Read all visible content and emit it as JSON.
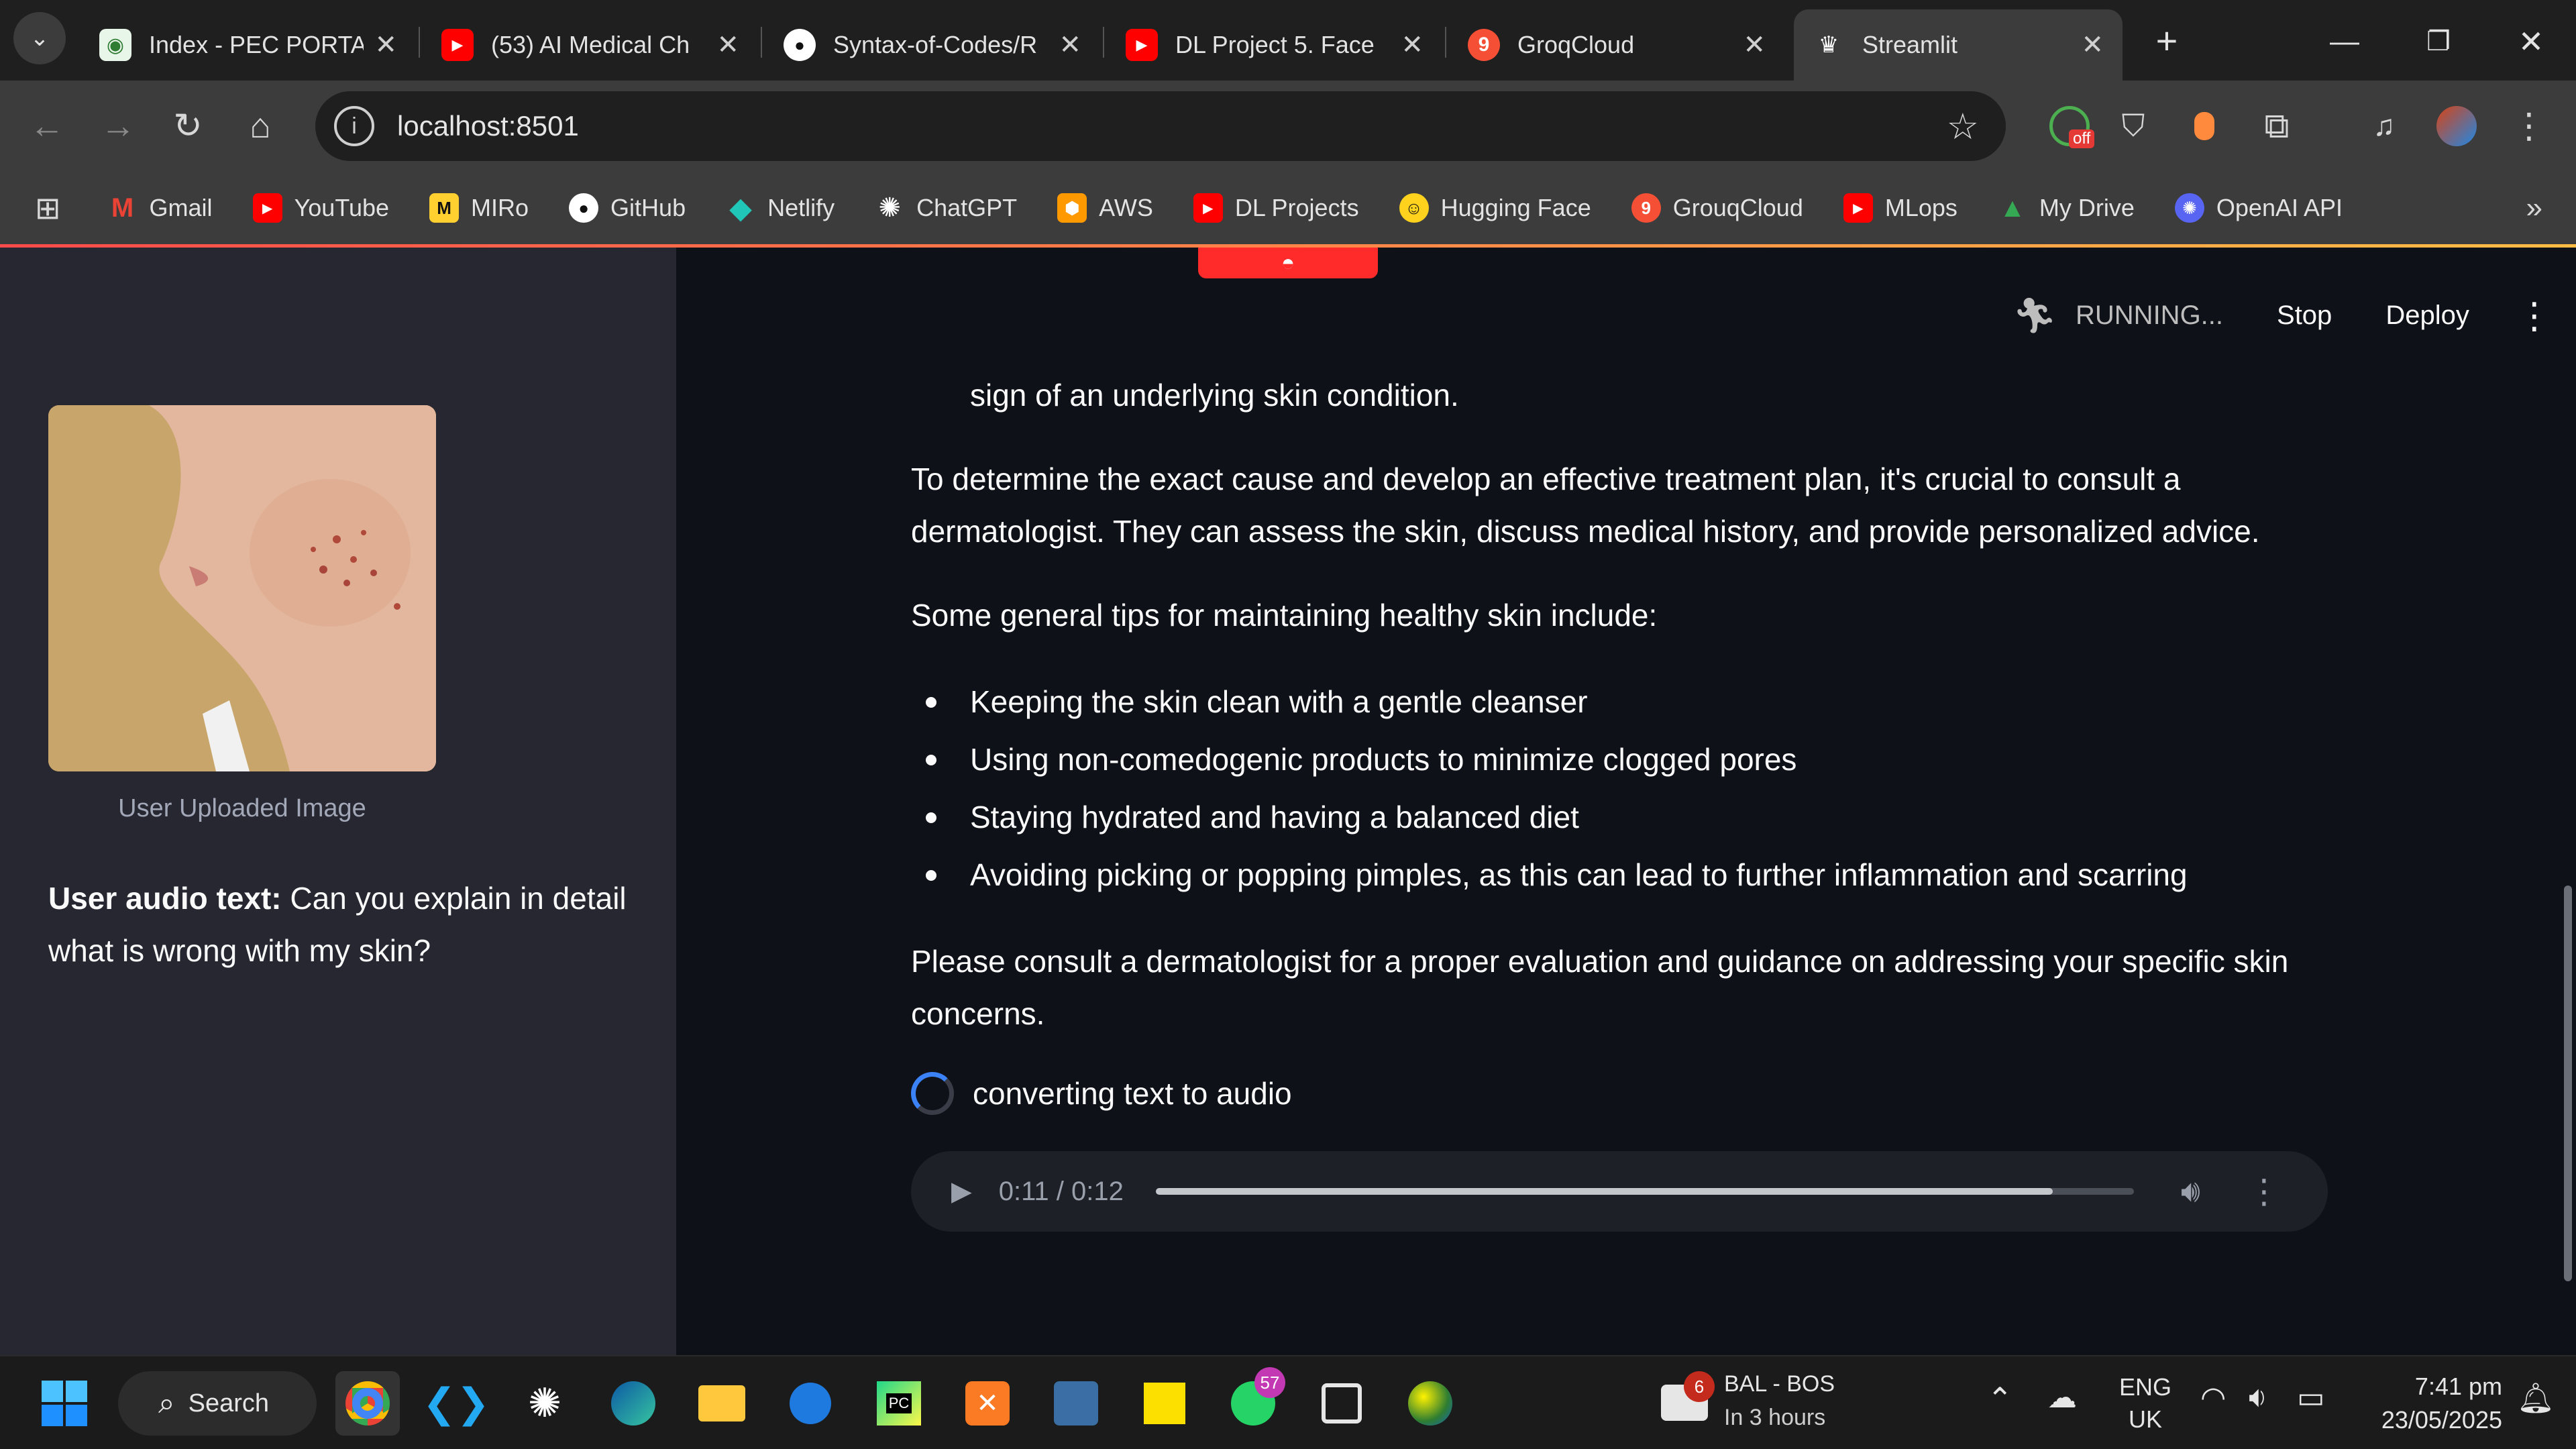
{
  "tabs": [
    {
      "title": "Index - PEC PORTAL",
      "favicon": "pec-icon",
      "color": "#4caf50"
    },
    {
      "title": "(53) AI Medical Ch",
      "favicon": "youtube-icon",
      "color": "#ff0000"
    },
    {
      "title": "Syntax-of-Codes/R",
      "favicon": "github-icon",
      "color": "#ffffff"
    },
    {
      "title": "DL Project 5. Face",
      "favicon": "youtube-icon",
      "color": "#ff0000"
    },
    {
      "title": "GroqCloud",
      "favicon": "groq-icon",
      "color": "#f55036"
    },
    {
      "title": "Streamlit",
      "favicon": "streamlit-icon",
      "color": "#ffffff"
    }
  ],
  "address": {
    "url": "localhost:8501"
  },
  "extensions": {
    "off_badge": "off"
  },
  "bookmarks": [
    {
      "label": "Gmail",
      "icon": "gmail-icon",
      "color": "#ea4335"
    },
    {
      "label": "YouTube",
      "icon": "youtube-icon",
      "color": "#ff0000"
    },
    {
      "label": "MIRo",
      "icon": "miro-icon",
      "color": "#ffd02f"
    },
    {
      "label": "GitHub",
      "icon": "github-icon",
      "color": "#ffffff"
    },
    {
      "label": "Netlify",
      "icon": "netlify-icon",
      "color": "#20c6b7"
    },
    {
      "label": "ChatGPT",
      "icon": "chatgpt-icon",
      "color": "#ffffff"
    },
    {
      "label": "AWS",
      "icon": "aws-icon",
      "color": "#ff9900"
    },
    {
      "label": "DL Projects",
      "icon": "youtube-icon",
      "color": "#ff0000"
    },
    {
      "label": "Hugging Face",
      "icon": "huggingface-icon",
      "color": "#ffd21e"
    },
    {
      "label": "GrouqCloud",
      "icon": "groq-icon",
      "color": "#f55036"
    },
    {
      "label": "MLops",
      "icon": "youtube-icon",
      "color": "#ff0000"
    },
    {
      "label": "My Drive",
      "icon": "drive-icon",
      "color": "#34a853"
    },
    {
      "label": "OpenAI API",
      "icon": "openai-icon",
      "color": "#5865f2"
    }
  ],
  "app": {
    "status": {
      "running": "RUNNING...",
      "stop": "Stop",
      "deploy": "Deploy"
    },
    "sidebar": {
      "image_caption": "User Uploaded Image",
      "audio_label": "User audio text:",
      "audio_text": "Can you explain in detail what is wrong with my skin?"
    },
    "content": {
      "partial_line": "sign of an underlying skin condition.",
      "para1": "To determine the exact cause and develop an effective treatment plan, it's crucial to consult a dermatologist. They can assess the skin, discuss medical history, and provide personalized advice.",
      "para2": "Some general tips for maintaining healthy skin include:",
      "tips": [
        "Keeping the skin clean with a gentle cleanser",
        "Using non-comedogenic products to minimize clogged pores",
        "Staying hydrated and having a balanced diet",
        "Avoiding picking or popping pimples, as this can lead to further inflammation and scarring"
      ],
      "para3": "Please consult a dermatologist for a proper evaluation and guidance on addressing your specific skin concerns.",
      "spinner_text": "converting text to audio"
    },
    "audio_player": {
      "time": "0:11 / 0:12",
      "progress_fraction": 0.917
    }
  },
  "taskbar": {
    "search_label": "Search",
    "whatsapp_badge": "57",
    "weather_badge": "6",
    "weather_title": "BAL - BOS",
    "weather_sub": "In 3 hours",
    "language": "ENG",
    "region": "UK",
    "time": "7:41 pm",
    "date": "23/05/2025"
  },
  "colors": {
    "accent": "#ff4b4b",
    "progress": "#3b82f6"
  }
}
